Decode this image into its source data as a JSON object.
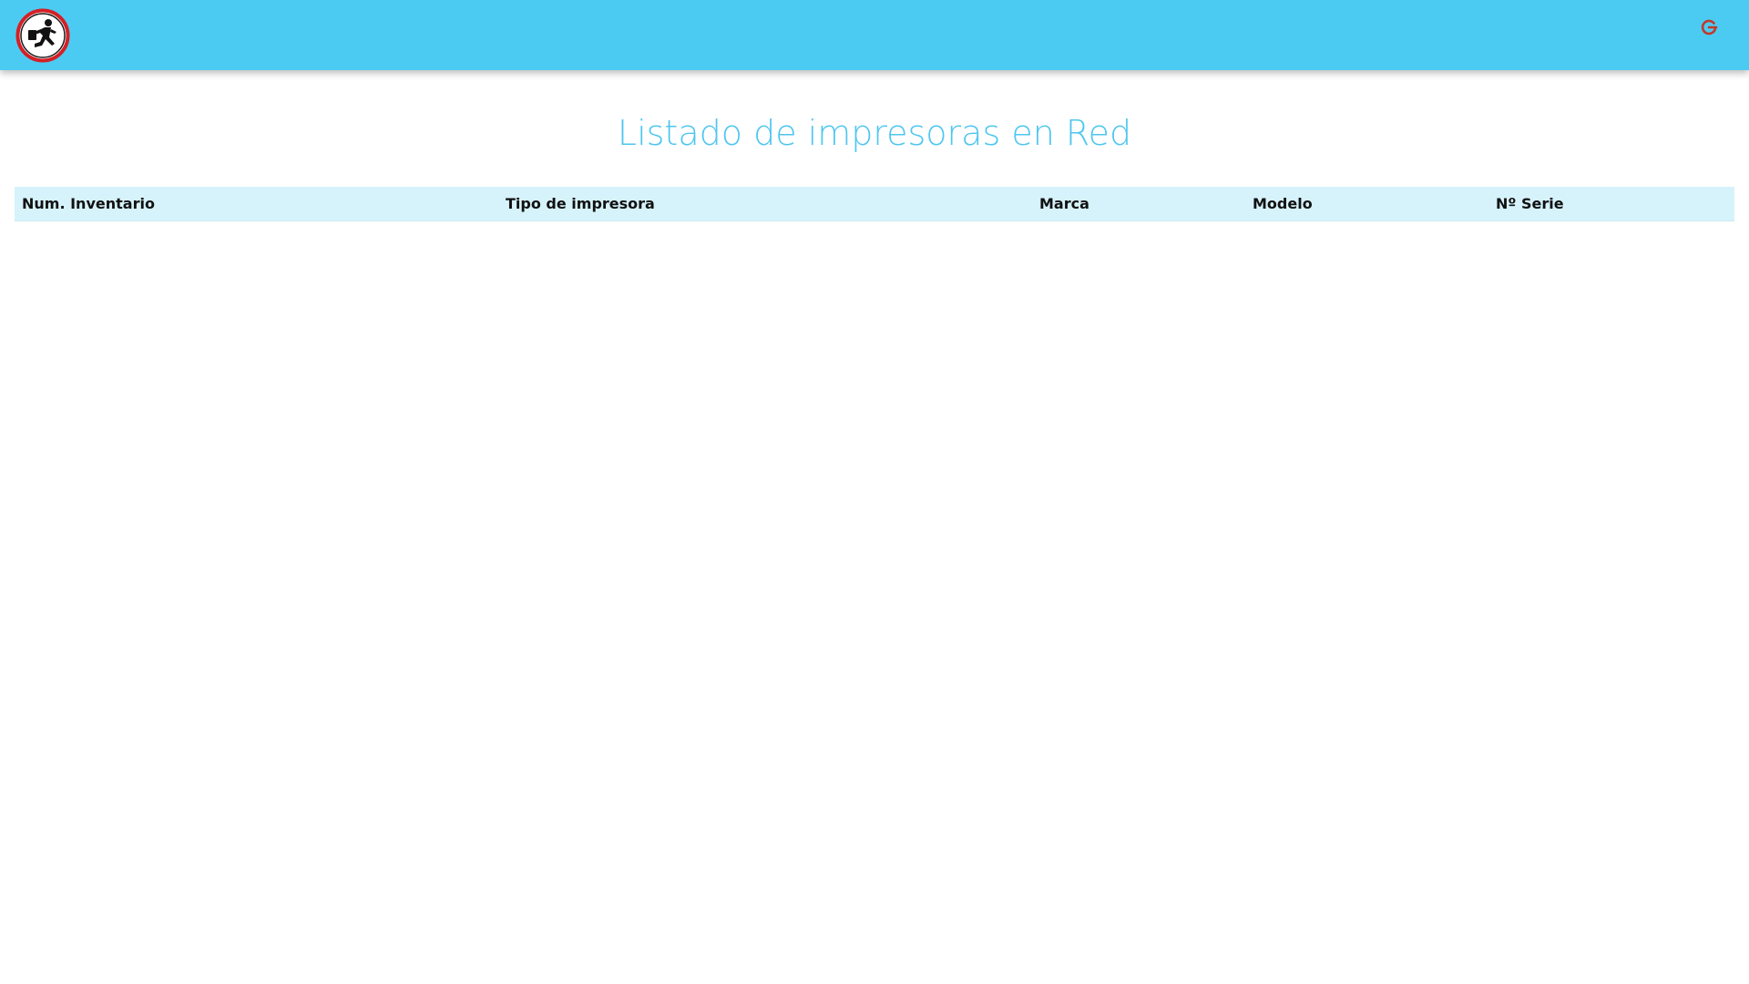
{
  "header": {
    "logo_icon": "running-man-prohibition-logo-icon",
    "logout_icon": "power-logout-icon",
    "background_color": "#4ccbf2",
    "logo_ring_color": "#d32026",
    "logout_icon_color": "#c0392b"
  },
  "main": {
    "title": "Listado de impresoras en Red",
    "title_color": "#4ec6ef"
  },
  "table": {
    "header_background": "#d6f3fb",
    "columns": [
      "Num. Inventario",
      "Tipo de impresora",
      "Marca",
      "Modelo",
      "Nº Serie"
    ],
    "rows": []
  }
}
